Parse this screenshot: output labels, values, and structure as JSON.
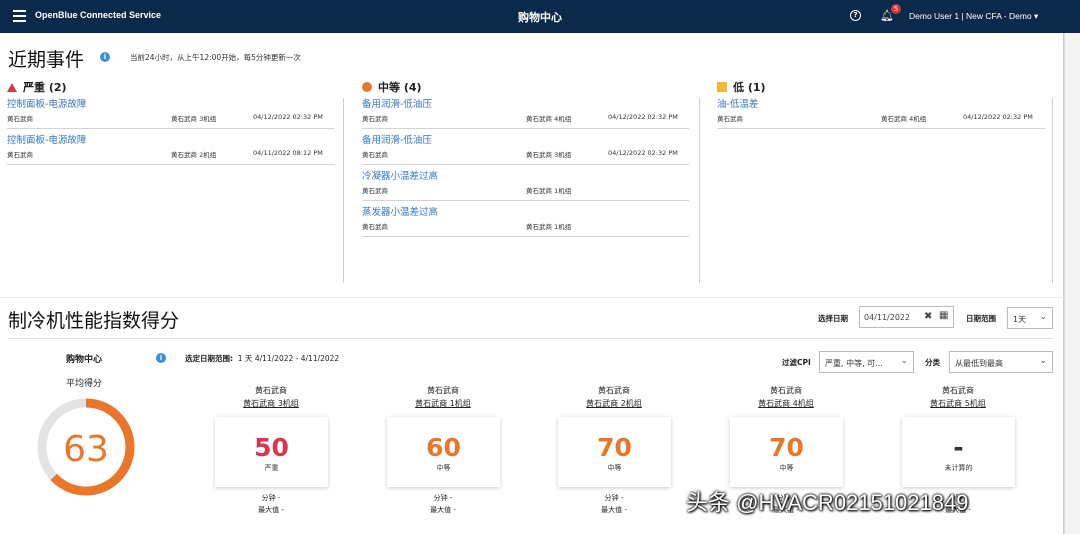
{
  "header": {
    "app_name": "OpenBlue Connected Service",
    "title": "购物中心",
    "help": "?",
    "notif_count": "5",
    "user": "Demo User 1 | New CFA - Demo ▾"
  },
  "events": {
    "title": "近期事件",
    "note": "当前24小时，从上午12:00开始，每5分钟更新一次",
    "high": {
      "label": "严重 (2)",
      "items": [
        {
          "title": "控制面板-电源故障",
          "site": "黄石武商",
          "unit": "黄石武商 3机组",
          "time": "04/12/2022 02:32 PM"
        },
        {
          "title": "控制面板-电源故障",
          "site": "黄石武商",
          "unit": "黄石武商 2机组",
          "time": "04/11/2022 08:12 PM"
        }
      ]
    },
    "medium": {
      "label": "中等 (4)",
      "items": [
        {
          "title": "备用润滑-低油压",
          "site": "黄石武商",
          "unit": "黄石武商 4机组",
          "time": "04/12/2022 02:32 PM"
        },
        {
          "title": "备用润滑-低油压",
          "site": "黄石武商",
          "unit": "黄石武商 3机组",
          "time": "04/12/2022 02:32 PM"
        },
        {
          "title": "冷凝器小温差过高",
          "site": "黄石武商",
          "unit": "黄石武商 1机组",
          "time": ""
        },
        {
          "title": "蒸发器小温差过高",
          "site": "黄石武商",
          "unit": "黄石武商 1机组",
          "time": ""
        }
      ]
    },
    "low": {
      "label": "低 (1)",
      "items": [
        {
          "title": "油-低温差",
          "site": "黄石武商",
          "unit": "黄石武商 4机组",
          "time": "04/12/2022 02:32 PM"
        }
      ]
    }
  },
  "cpi": {
    "title": "制冷机性能指数得分",
    "select_date_label": "选择日期",
    "date_value": "04/11/2022",
    "date_range_label": "日期范围",
    "date_range_value": "1天",
    "site": "购物中心",
    "avg_label": "平均得分",
    "avg_score": 63,
    "avg_color": "#e9762a",
    "range_label": "选定日期范围:",
    "range_value": "1 天   4/11/2022 - 4/11/2022",
    "filter_label": "过滤CPI",
    "filter_value": "严重, 中等, 可...",
    "sort_label": "分类",
    "sort_value": "从最低到最高",
    "units": [
      {
        "site": "黄石武商",
        "name": "黄石武商 3机组",
        "score": "50",
        "level": "严重",
        "color": "#d9364e",
        "minute": "分钟 -",
        "max": "最大值 -"
      },
      {
        "site": "黄石武商",
        "name": "黄石武商 1机组",
        "score": "60",
        "level": "中等",
        "color": "#e9762a",
        "minute": "分钟 -",
        "max": "最大值 -"
      },
      {
        "site": "黄石武商",
        "name": "黄石武商 2机组",
        "score": "70",
        "level": "中等",
        "color": "#e9762a",
        "minute": "分钟 -",
        "max": "最大值 -"
      },
      {
        "site": "黄石武商",
        "name": "黄石武商 4机组",
        "score": "70",
        "level": "中等",
        "color": "#e9762a",
        "minute": "分钟 -",
        "max": "最大值 -"
      },
      {
        "site": "黄石武商",
        "name": "黄石武商 5机组",
        "score": "-",
        "level": "未计算的",
        "color": "#333333",
        "minute": "分钟 -",
        "max": "最大值 -"
      }
    ]
  },
  "watermark": "头条 @HVACR02151021849"
}
